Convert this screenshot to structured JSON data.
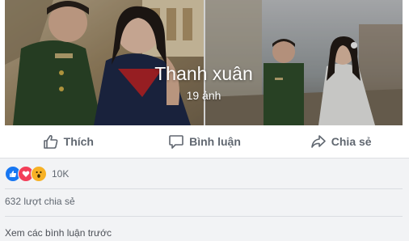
{
  "album": {
    "title": "Thanh xuân",
    "count": "19 ảnh"
  },
  "actions": {
    "like": "Thích",
    "comment": "Bình luận",
    "share": "Chia sẻ"
  },
  "reactions": {
    "icons": [
      "like-icon",
      "love-icon",
      "wow-icon"
    ],
    "count": "10K",
    "colors": {
      "like": "#1877f2",
      "love": "#f33e58",
      "wow": "#f7b125"
    }
  },
  "shares_text": "632 lượt chia sẻ",
  "view_previous_comments": "Xem các bình luận trước"
}
